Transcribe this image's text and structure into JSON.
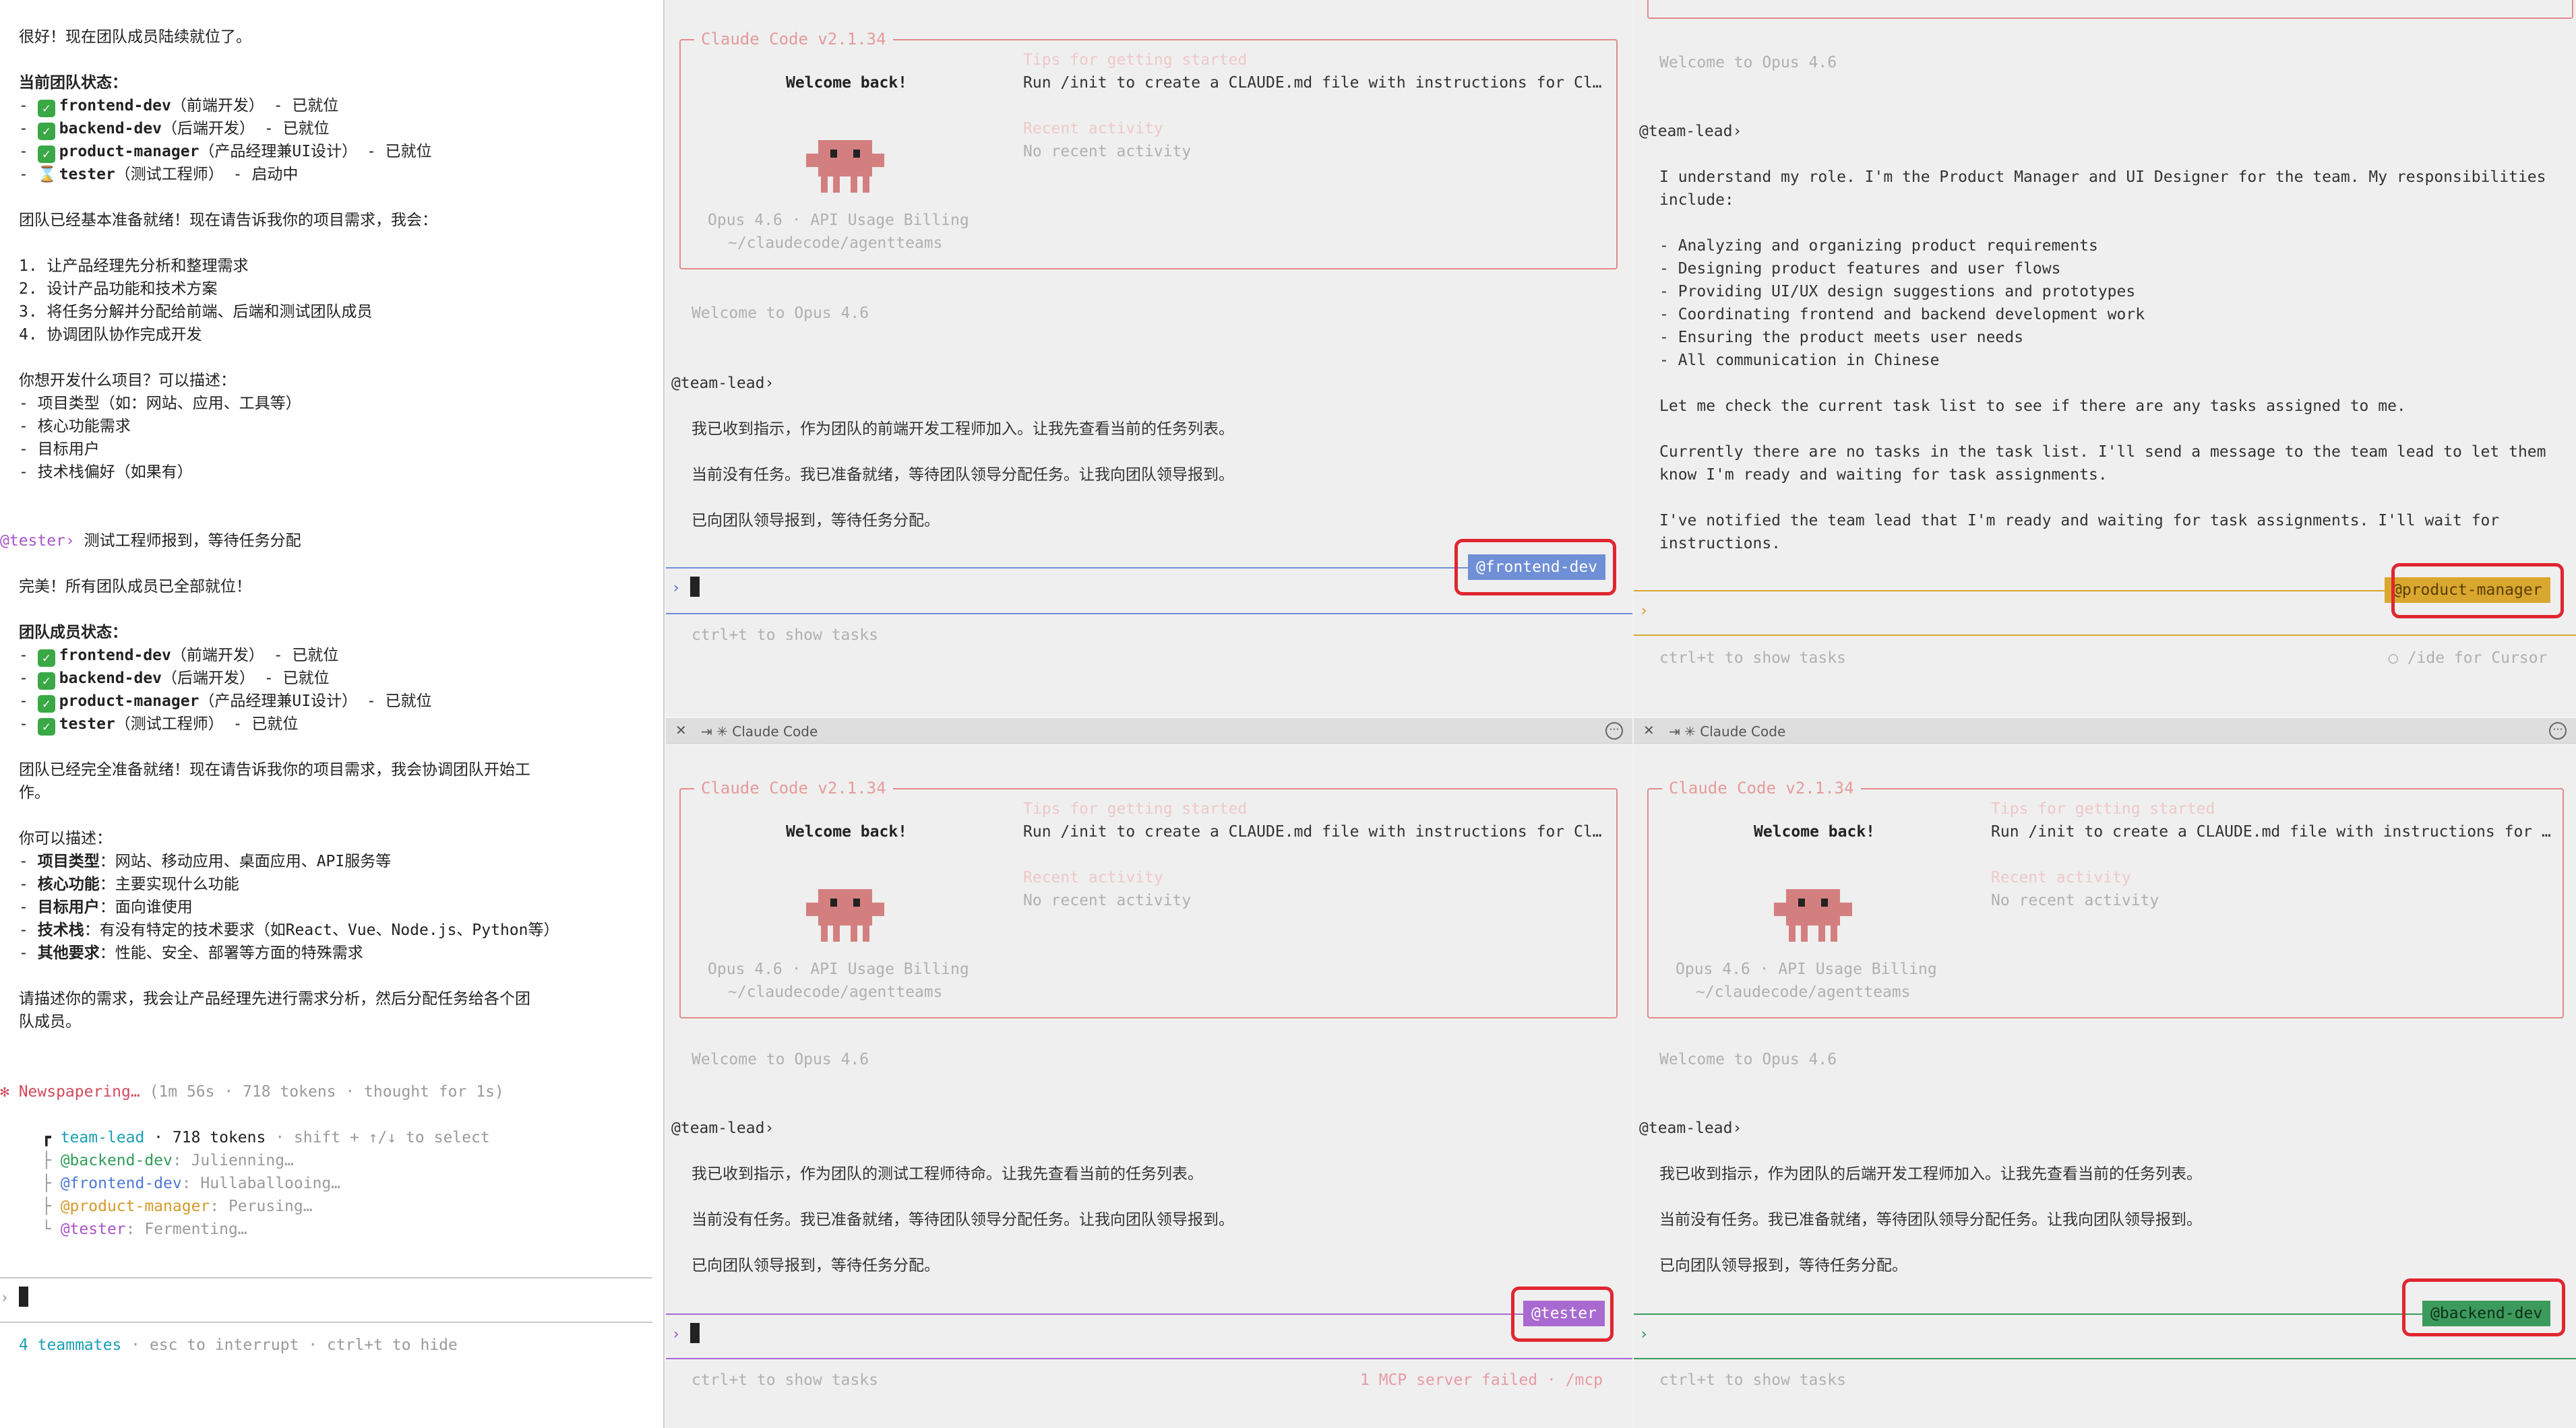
{
  "lead": {
    "lines": [
      "很好！现在团队成员陆续就位了。",
      "当前团队状态：",
      "团队已经基本准备就绪！现在请告诉我你的项目需求，我会：",
      "1. 让产品经理先分析和整理需求",
      "2. 设计产品功能和技术方案",
      "3. 将任务分解并分配给前端、后端和测试团队成员",
      "4. 协调团队协作完成开发",
      "你想开发什么项目？可以描述：",
      "- 项目类型（如：网站、应用、工具等）",
      "- 核心功能需求",
      "- 目标用户",
      "- 技术栈偏好（如果有）"
    ],
    "status1": [
      {
        "name": "frontend-dev",
        "desc": "（前端开发） - 已就位",
        "mark": "✓"
      },
      {
        "name": "backend-dev",
        "desc": "（后端开发） - 已就位",
        "mark": "✓"
      },
      {
        "name": "product-manager",
        "desc": "（产品经理兼UI设计） - 已就位",
        "mark": "✓"
      },
      {
        "name": "tester",
        "desc": "（测试工程师） - 启动中",
        "mark": "⌛"
      }
    ],
    "tester_handle": "@tester",
    "tester_msg": " 测试工程师报到，等待任务分配",
    "perfect": "完美！所有团队成员已全部就位！",
    "status2_title": "团队成员状态：",
    "status2": [
      {
        "name": "frontend-dev",
        "desc": "（前端开发） - 已就位"
      },
      {
        "name": "backend-dev",
        "desc": "（后端开发） - 已就位"
      },
      {
        "name": "product-manager",
        "desc": "（产品经理兼UI设计） - 已就位"
      },
      {
        "name": "tester",
        "desc": "（测试工程师） - 已就位"
      }
    ],
    "ready_1": "团队已经完全准备就绪！现在请告诉我你的项目需求，我会协调团队开始工",
    "ready_2": "作。",
    "can_describe": "你可以描述：",
    "describe": [
      {
        "k": "项目类型",
        "v": "：网站、移动应用、桌面应用、API服务等"
      },
      {
        "k": "核心功能",
        "v": "：主要实现什么功能"
      },
      {
        "k": "目标用户",
        "v": "：面向谁使用"
      },
      {
        "k": "技术栈",
        "v": "：有没有特定的技术要求（如React、Vue、Node.js、Python等）"
      },
      {
        "k": "其他要求",
        "v": "：性能、安全、部署等方面的特殊需求"
      }
    ],
    "final_1": "请描述你的需求，我会让产品经理先进行需求分析，然后分配任务给各个团",
    "final_2": "队成员。",
    "spinner": "✻ Newspapering…",
    "spinner_meta": " (1m 56s · 718 tokens · thought for 1s)",
    "tree": {
      "lead": "team-lead",
      "lead_meta": " · 718 tokens",
      "hint": " · shift + ↑/↓ to select",
      "members": [
        {
          "handle": "@backend-dev",
          "state": ": Julienning…"
        },
        {
          "handle": "@frontend-dev",
          "state": ": Hullaballooing…"
        },
        {
          "handle": "@product-manager",
          "state": ": Perusing…"
        },
        {
          "handle": "@tester",
          "state": ": Fermenting…"
        }
      ]
    },
    "prompt": "›",
    "footer_count": "4 teammates",
    "footer_rest": " · esc to interrupt · ctrl+t to hide"
  },
  "panes": {
    "title": "Claude Code",
    "box_label": "Claude Code v2.1.34",
    "welcome_back": "Welcome back!",
    "tips_header": "Tips for getting started",
    "tips_text": "Run /init to create a CLAUDE.md file with instructions for Cl…",
    "tips_text_long": "Run /init to create a CLAUDE.md file with instructions for …",
    "recent_header": "Recent activity",
    "recent_text": "No recent activity",
    "model": "Opus 4.6 · API Usage Billing",
    "path": "~/claudecode/agentteams",
    "welcome_opus": "Welcome to Opus 4.6",
    "team_lead": "@team-lead›",
    "prompt": "›",
    "ctrl_t": "ctrl+t to show tasks",
    "ide_hint": "◯ /ide for Cursor",
    "mcp_fail": "1 MCP server failed · /mcp",
    "frontend": {
      "tag": "@frontend-dev",
      "msgs": [
        "我已收到指示，作为团队的前端开发工程师加入。让我先查看当前的任务列表。",
        "当前没有任务。我已准备就绪，等待团队领导分配任务。让我向团队领导报到。",
        "已向团队领导报到，等待任务分配。"
      ]
    },
    "pm": {
      "tag": "@product-manager",
      "lines": [
        "I understand my role. I'm the Product Manager and UI Designer for the team. My responsibilities",
        "include:",
        "- Analyzing and organizing product requirements",
        "- Designing product features and user flows",
        "- Providing UI/UX design suggestions and prototypes",
        "- Coordinating frontend and backend development work",
        "- Ensuring the product meets user needs",
        "- All communication in Chinese",
        "Let me check the current task list to see if there are any tasks assigned to me.",
        "Currently there are no tasks in the task list. I'll send a message to the team lead to let them",
        "know I'm ready and waiting for task assignments.",
        "I've notified the team lead that I'm ready and waiting for task assignments. I'll wait for",
        "instructions."
      ]
    },
    "tester": {
      "tag": "@tester",
      "msgs": [
        "我已收到指示，作为团队的测试工程师待命。让我先查看当前的任务列表。",
        "当前没有任务。我已准备就绪，等待团队领导分配任务。让我向团队领导报到。",
        "已向团队领导报到，等待任务分配。"
      ]
    },
    "backend": {
      "tag": "@backend-dev",
      "msgs": [
        "我已收到指示，作为团队的后端开发工程师加入。让我先查看当前的任务列表。",
        "当前没有任务。我已准备就绪，等待团队领导分配任务。让我向团队领导报到。",
        "已向团队领导报到，等待任务分配。"
      ]
    }
  },
  "colors": {
    "frontend": "#6f8fd6",
    "pm": "#d9a72e",
    "tester": "#a86ad0",
    "backend": "#3c9b5c",
    "callout": "#e0262f",
    "crab": "#d47f7f"
  }
}
